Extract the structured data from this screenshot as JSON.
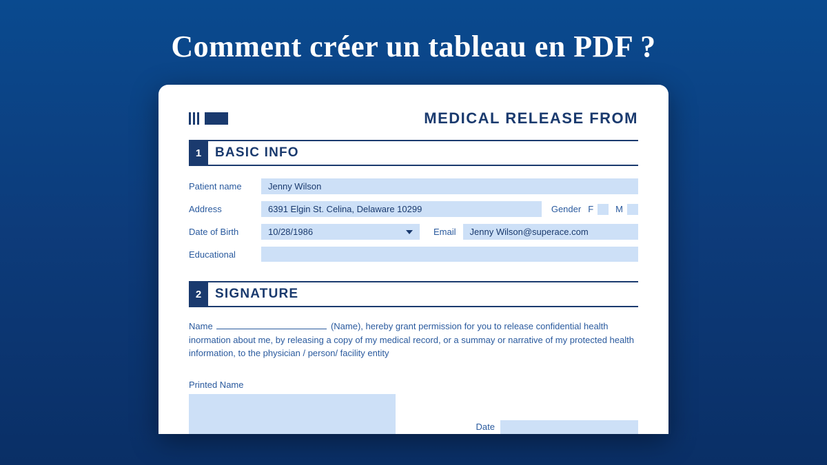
{
  "pageTitle": "Comment créer un tableau en PDF ?",
  "formTitle": "MEDICAL RELEASE FROM",
  "sections": {
    "basic": {
      "num": "1",
      "title": "BASIC INFO"
    },
    "signature": {
      "num": "2",
      "title": "SIGNATURE"
    }
  },
  "labels": {
    "patientName": "Patient name",
    "address": "Address",
    "dob": "Date of Birth",
    "educational": "Educational",
    "gender": "Gender",
    "genderF": "F",
    "genderM": "M",
    "email": "Email",
    "consentName": "Name",
    "printedName": "Printed Name",
    "date": "Date"
  },
  "values": {
    "patientName": "Jenny Wilson",
    "address": "6391 Elgin St. Celina, Delaware 10299",
    "dob": "10/28/1986",
    "email": "Jenny Wilson@superace.com",
    "educational": ""
  },
  "consentText": "(Name), hereby grant permission for you to release confidential health inormation about me, by releasing a copy of my medical record, or a summay or narrative of my protected health information, to the physician / person/ facility entity"
}
